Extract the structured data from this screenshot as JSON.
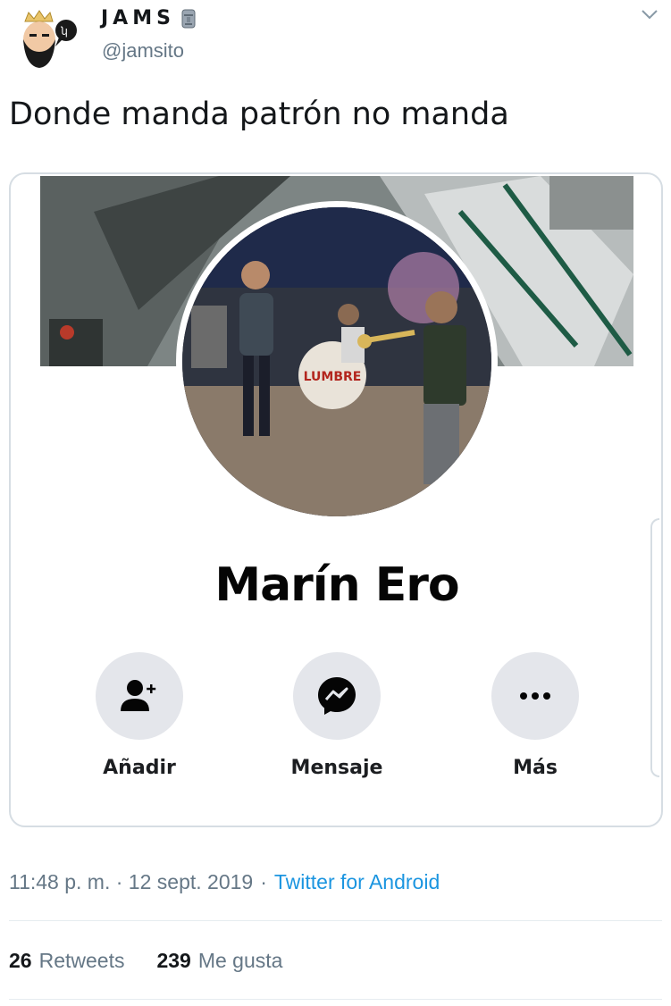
{
  "tweet": {
    "author_name": "JAMS",
    "author_handle": "@jamsito",
    "text": "Donde manda patrón no manda",
    "timestamp": "11:48 p. m. · 12 sept. 2019",
    "separator": "·",
    "source": "Twitter for Android",
    "retweets_count": "26",
    "retweets_label": "Retweets",
    "likes_count": "239",
    "likes_label": "Me gusta"
  },
  "profile_card": {
    "name": "Marín Ero",
    "actions": [
      {
        "label": "Añadir",
        "icon": "add-friend-icon"
      },
      {
        "label": "Mensaje",
        "icon": "messenger-icon"
      },
      {
        "label": "Más",
        "icon": "more-icon"
      }
    ],
    "drum_text": "LUMBRE"
  },
  "colors": {
    "link": "#1b95e0",
    "muted": "#657786",
    "action_bg": "#e4e6eb",
    "card_border": "#d6dde3"
  }
}
